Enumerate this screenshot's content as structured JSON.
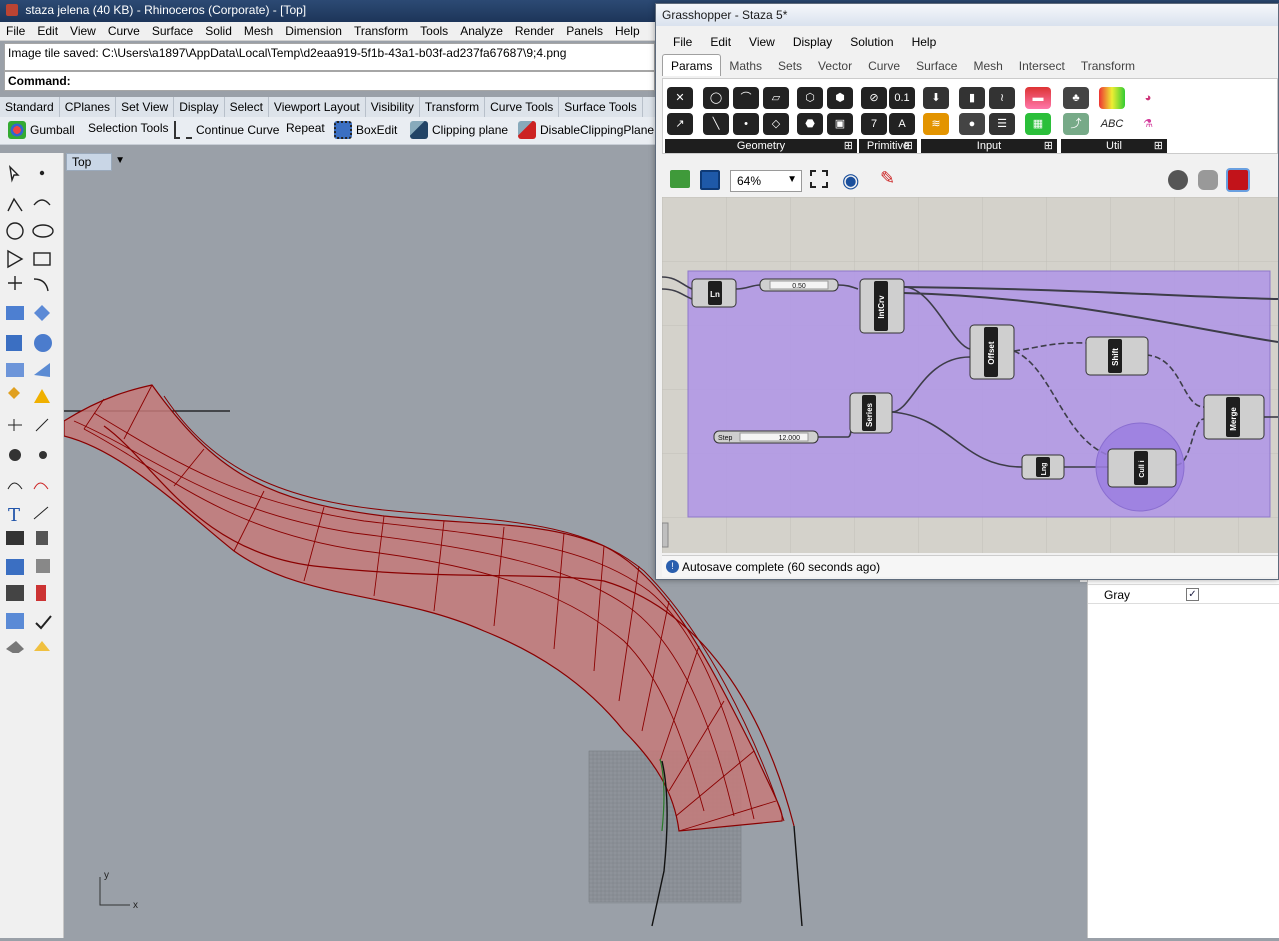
{
  "rhino": {
    "title": "staza jelena (40 KB) - Rhinoceros (Corporate) - [Top]",
    "menu": [
      "File",
      "Edit",
      "View",
      "Curve",
      "Surface",
      "Solid",
      "Mesh",
      "Dimension",
      "Transform",
      "Tools",
      "Analyze",
      "Render",
      "Panels",
      "Help"
    ],
    "history_line": "Image tile saved: C:\\Users\\a1897\\AppData\\Local\\Temp\\d2eaa919-5f1b-43a1-b03f-ad237fa67687\\9;4.png",
    "command_label": "Command:",
    "toolbar_tabs": [
      "Standard",
      "CPlanes",
      "Set View",
      "Display",
      "Select",
      "Viewport Layout",
      "Visibility",
      "Transform",
      "Curve Tools",
      "Surface Tools"
    ],
    "toolbar_items": [
      {
        "label": "Gumball",
        "icon": "gumball-icon"
      },
      {
        "label": "Selection Tools",
        "icon": "selection-tools-icon"
      },
      {
        "label": "Continue Curve",
        "icon": "continue-curve-icon"
      },
      {
        "label": "Repeat",
        "icon": "repeat-icon"
      },
      {
        "label": "BoxEdit",
        "icon": "boxedit-icon"
      },
      {
        "label": "Clipping plane",
        "icon": "clipping-plane-icon"
      },
      {
        "label": "DisableClippingPlane",
        "icon": "disable-clipping-plane-icon"
      }
    ],
    "viewport": {
      "name": "Top",
      "axis_x": "x",
      "axis_y": "y"
    },
    "panel": {
      "gray_label": "Gray",
      "gray_checked": true
    }
  },
  "grasshopper": {
    "title": "Grasshopper - Staza 5*",
    "menu": [
      "File",
      "Edit",
      "View",
      "Display",
      "Solution",
      "Help"
    ],
    "tabs": [
      "Params",
      "Maths",
      "Sets",
      "Vector",
      "Curve",
      "Surface",
      "Mesh",
      "Intersect",
      "Transform"
    ],
    "active_tab": "Params",
    "groups": [
      "Geometry",
      "Primitive",
      "Input",
      "Util"
    ],
    "zoom": "64%",
    "status": "Autosave complete (60 seconds ago)",
    "components": {
      "ln": "Ln",
      "slider_value": "0.50",
      "intcrv": "IntCrv",
      "offset": "Offset",
      "shift": "Shift",
      "series": "Series",
      "step_label": "Step",
      "step_value": "12.000",
      "merge": "Merge",
      "lng": "Lng",
      "cull": "Cull i"
    }
  }
}
